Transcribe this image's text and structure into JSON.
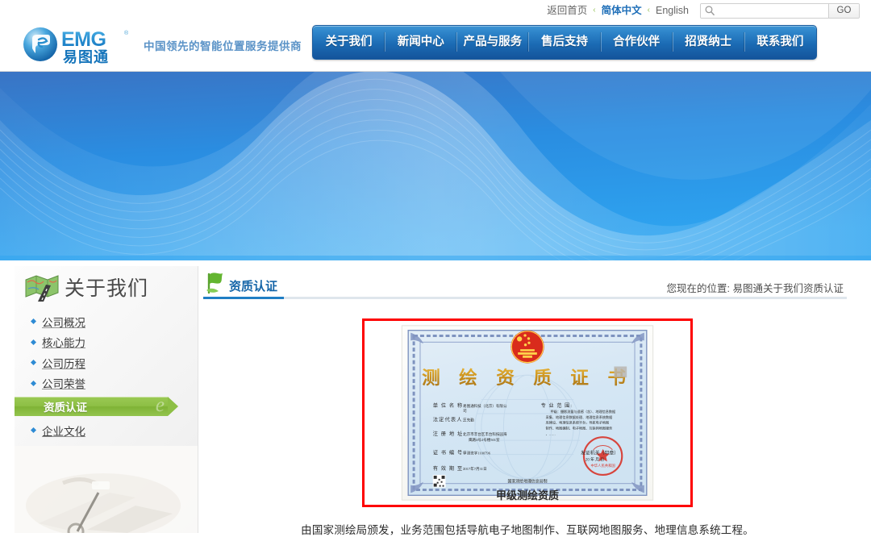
{
  "topbar": {
    "home_link": "返回首页",
    "separator": "‹",
    "lang_zh": "简体中文",
    "lang_en": "English",
    "search_placeholder": "",
    "search_value": "",
    "go_label": "GO"
  },
  "header": {
    "logo_text": "EMG",
    "logo_sub": "易图通",
    "logo_mark": "®",
    "tagline": "中国领先的智能位置服务提供商"
  },
  "nav": {
    "items": [
      {
        "label": "关于我们"
      },
      {
        "label": "新闻中心"
      },
      {
        "label": "产品与服务"
      },
      {
        "label": "售后支持"
      },
      {
        "label": "合作伙伴"
      },
      {
        "label": "招贤纳士"
      },
      {
        "label": "联系我们"
      }
    ]
  },
  "sidebar": {
    "title": "关于我们",
    "items": [
      {
        "label": "公司概况",
        "active": false
      },
      {
        "label": "核心能力",
        "active": false
      },
      {
        "label": "公司历程",
        "active": false
      },
      {
        "label": "公司荣誉",
        "active": false
      },
      {
        "label": "资质认证",
        "active": true
      },
      {
        "label": "企业文化",
        "active": false
      }
    ]
  },
  "content": {
    "section_title": "资质认证",
    "breadcrumb": "您现在的位置: 易图通关于我们资质认证",
    "certificate": {
      "caption": "甲级测绘资质",
      "description": "由国家测绘局颁发，业务范围包括导航电子地图制作、互联网地图服务、地理信息系统工程。",
      "document_title": "测 绘 资 质 证 书",
      "fields": [
        {
          "label": "单 位 名 称:",
          "value": "易图通科技（北京）有限公司"
        },
        {
          "label": "法定代表人:",
          "value": "王先勤"
        },
        {
          "label": "注 册 地 址:",
          "value": "北京市丰台区丰台科技园海鹰路4号2号楼501室"
        },
        {
          "label": "证 书 编 号:",
          "value": "甲测资字1100796"
        },
        {
          "label": "有 效 期 至:",
          "value": "2017年7月31日"
        }
      ],
      "scope_label": "专 业 范 围:",
      "scope_value": "甲级：摄影测量与遥感（含航空航天遥感、地理信息系统工程、地理信息数据采集、地理信息系统数据处理、地理信息系统数据库建设、地理信息系统应用平台），导航电子地图制作，地图编制，电子地图，互联网地图服务。",
      "issuer": "国家测绘地理信息局制",
      "seal_text": "发证机关（印章）",
      "border_color": "#fe0000"
    }
  },
  "colors": {
    "nav_blue_top": "#3e95d4",
    "nav_blue_bottom": "#14549b",
    "accent_green": "#8dbf45",
    "link_blue": "#1565a8",
    "banner_blue": "#2b8fe0"
  }
}
